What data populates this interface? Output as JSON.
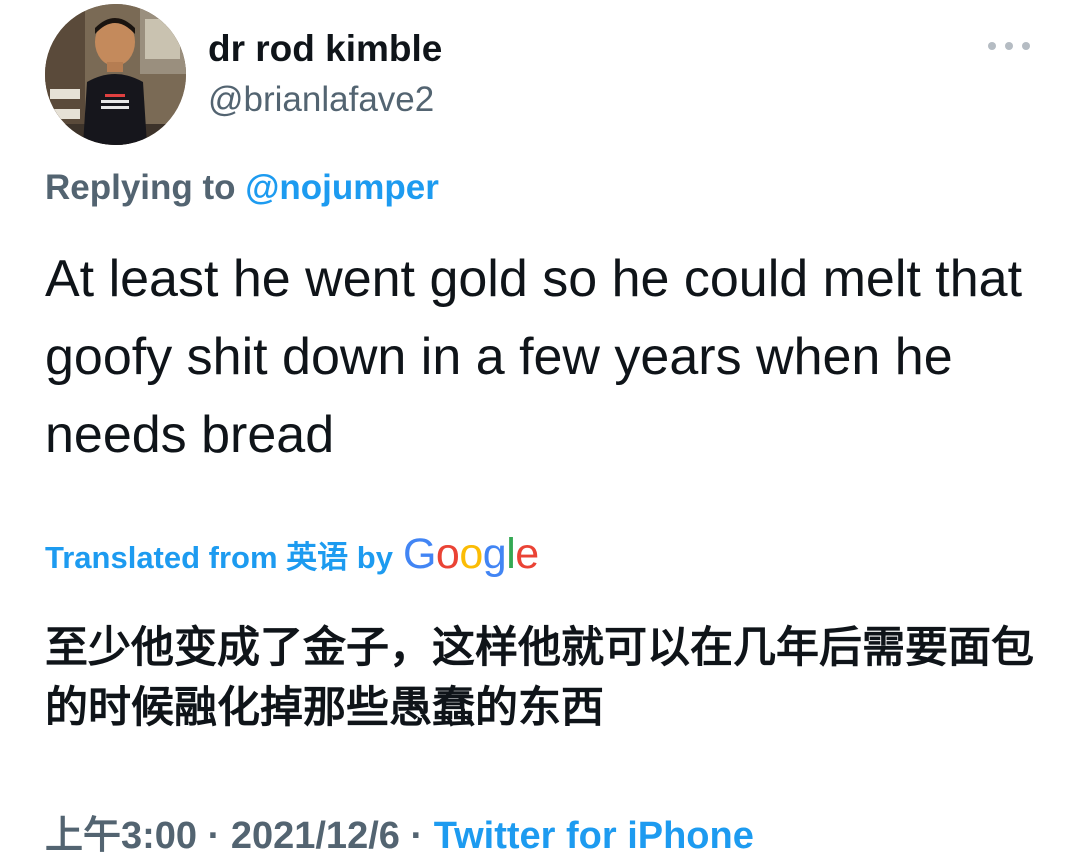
{
  "user": {
    "display_name": "dr rod kimble",
    "handle": "@brianlafave2",
    "avatar_icon": "profile-photo"
  },
  "more_icon": "more-horizontal-icon",
  "reply": {
    "prefix": "Replying to",
    "mention": "@nojumper"
  },
  "tweet": {
    "text": "At least he went gold so he could melt that goofy shit down in a few years when he needs bread"
  },
  "translation": {
    "label": "Translated from 英语 by",
    "provider": "Google",
    "text": "至少他变成了金子，这样他就可以在几年后需要面包的时候融化掉那些愚蠢的东西"
  },
  "meta": {
    "time": "上午3:00",
    "separator": "·",
    "date": "2021/12/6",
    "source": "Twitter for iPhone"
  },
  "colors": {
    "link": "#1d9bf0",
    "secondary": "#536471",
    "primary": "#0f1419"
  }
}
